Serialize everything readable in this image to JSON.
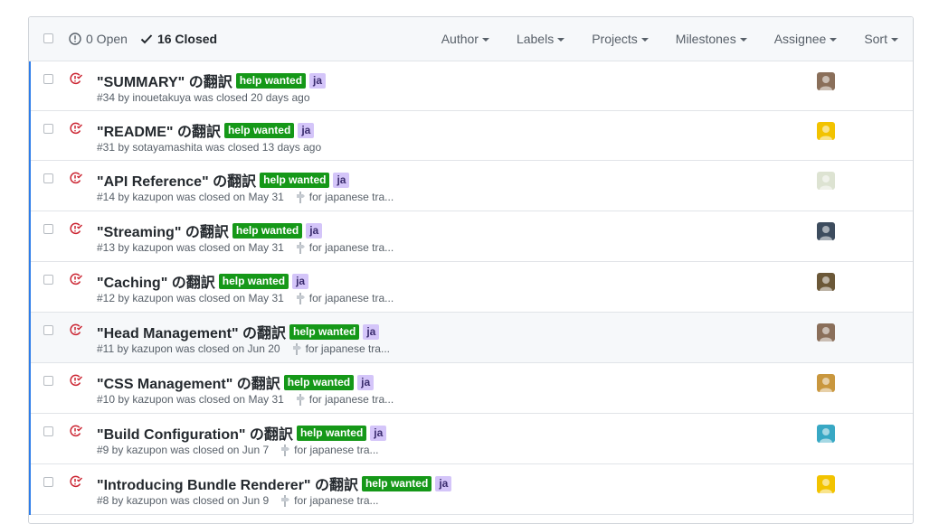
{
  "header": {
    "open_label": "0 Open",
    "closed_label": "16 Closed",
    "filters": [
      "Author",
      "Labels",
      "Projects",
      "Milestones",
      "Assignee",
      "Sort"
    ]
  },
  "issues": [
    {
      "title": "\"SUMMARY\" の翻訳",
      "labels": [
        "help wanted",
        "ja"
      ],
      "meta": "#34 by inouetakuya was closed 20 days ago",
      "milestone": "",
      "avatar_color": "#8a6f5a"
    },
    {
      "title": "\"README\" の翻訳",
      "labels": [
        "help wanted",
        "ja"
      ],
      "meta": "#31 by sotayamashita was closed 13 days ago",
      "milestone": "",
      "avatar_color": "#f2c300"
    },
    {
      "title": "\"API Reference\" の翻訳",
      "labels": [
        "help wanted",
        "ja"
      ],
      "meta": "#14 by kazupon was closed on May 31",
      "milestone": "for japanese tra...",
      "avatar_color": "#dde3d2"
    },
    {
      "title": "\"Streaming\" の翻訳",
      "labels": [
        "help wanted",
        "ja"
      ],
      "meta": "#13 by kazupon was closed on May 31",
      "milestone": "for japanese tra...",
      "avatar_color": "#3d4c5e"
    },
    {
      "title": "\"Caching\" の翻訳",
      "labels": [
        "help wanted",
        "ja"
      ],
      "meta": "#12 by kazupon was closed on May 31",
      "milestone": "for japanese tra...",
      "avatar_color": "#6b5838"
    },
    {
      "title": "\"Head Management\" の翻訳",
      "labels": [
        "help wanted",
        "ja"
      ],
      "meta": "#11 by kazupon was closed on Jun 20",
      "milestone": "for japanese tra...",
      "avatar_color": "#8a6f5a"
    },
    {
      "title": "\"CSS Management\" の翻訳",
      "labels": [
        "help wanted",
        "ja"
      ],
      "meta": "#10 by kazupon was closed on May 31",
      "milestone": "for japanese tra...",
      "avatar_color": "#c9973e"
    },
    {
      "title": "\"Build Configuration\" の翻訳",
      "labels": [
        "help wanted",
        "ja"
      ],
      "meta": "#9 by kazupon was closed on Jun 7",
      "milestone": "for japanese tra...",
      "avatar_color": "#38a8c4"
    },
    {
      "title": "\"Introducing Bundle Renderer\" の翻訳",
      "labels": [
        "help wanted",
        "ja"
      ],
      "meta": "#8 by kazupon was closed on Jun 9",
      "milestone": "for japanese tra...",
      "avatar_color": "#f2c300"
    }
  ],
  "colors": {
    "help_wanted": "#159818",
    "ja": "#d4c5f9",
    "closed_icon": "#cb2431",
    "accent_bar": "#2e7de9"
  }
}
